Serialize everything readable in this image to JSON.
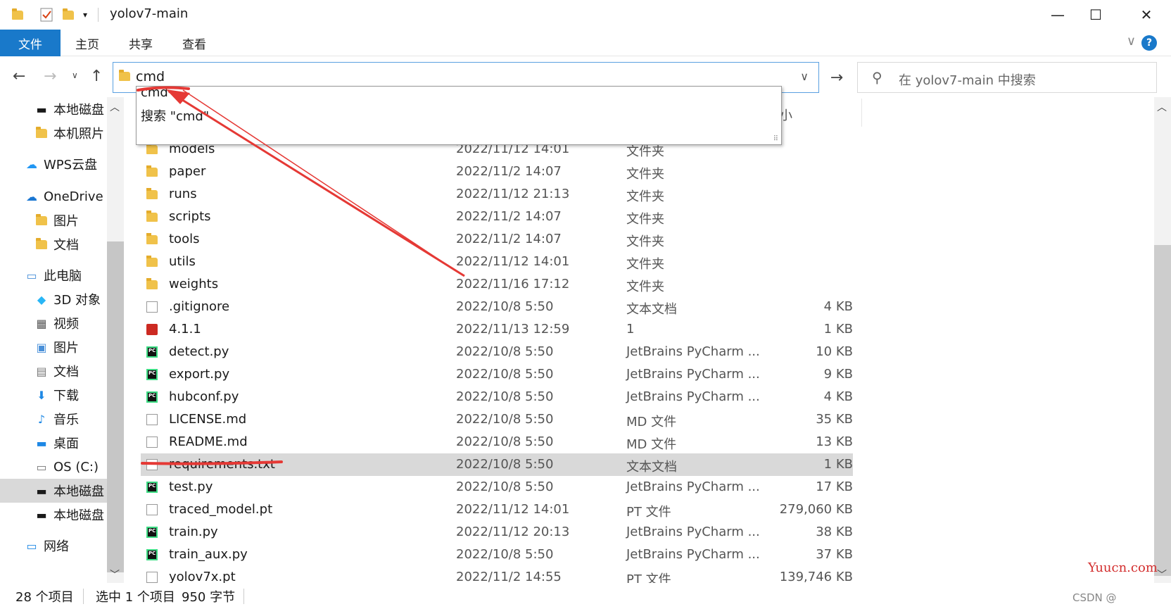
{
  "window": {
    "title": "yolov7-main",
    "minimize_icon": "—",
    "maximize_icon": "☐",
    "close_icon": "✕"
  },
  "ribbon": {
    "tabs": [
      "文件",
      "主页",
      "共享",
      "查看"
    ],
    "help": "?",
    "expand_icon": "∨"
  },
  "address": {
    "value": "cmd",
    "search_placeholder": "在 yolov7-main 中搜索"
  },
  "autocomplete": {
    "items": [
      "cmd",
      "搜索 \"cmd\""
    ]
  },
  "sidebar": {
    "items": [
      {
        "label": "本地磁盘",
        "icon": "drive-icon"
      },
      {
        "label": "本机照片",
        "icon": "folder-icon"
      },
      {
        "label": "WPS云盘",
        "icon": "cloud-icon"
      },
      {
        "label": "OneDrive",
        "icon": "onedrive-icon"
      },
      {
        "label": "图片",
        "icon": "folder-icon"
      },
      {
        "label": "文档",
        "icon": "folder-icon"
      },
      {
        "label": "此电脑",
        "icon": "computer-icon"
      },
      {
        "label": "3D 对象",
        "icon": "cube-icon"
      },
      {
        "label": "视频",
        "icon": "video-icon"
      },
      {
        "label": "图片",
        "icon": "pictures-icon"
      },
      {
        "label": "文档",
        "icon": "documents-icon"
      },
      {
        "label": "下载",
        "icon": "download-icon"
      },
      {
        "label": "音乐",
        "icon": "music-icon"
      },
      {
        "label": "桌面",
        "icon": "desktop-icon"
      },
      {
        "label": "OS (C:)",
        "icon": "os-drive-icon"
      },
      {
        "label": "本地磁盘",
        "icon": "drive-icon"
      },
      {
        "label": "本地磁盘",
        "icon": "drive-icon"
      },
      {
        "label": "网络",
        "icon": "network-icon"
      }
    ]
  },
  "list": {
    "size_header": "小",
    "rows": [
      {
        "name": "models",
        "date": "2022/11/12 14:01",
        "type": "文件夹",
        "size": "",
        "icon": "folder"
      },
      {
        "name": "paper",
        "date": "2022/11/2 14:07",
        "type": "文件夹",
        "size": "",
        "icon": "folder"
      },
      {
        "name": "runs",
        "date": "2022/11/12 21:13",
        "type": "文件夹",
        "size": "",
        "icon": "folder"
      },
      {
        "name": "scripts",
        "date": "2022/11/2 14:07",
        "type": "文件夹",
        "size": "",
        "icon": "folder"
      },
      {
        "name": "tools",
        "date": "2022/11/2 14:07",
        "type": "文件夹",
        "size": "",
        "icon": "folder"
      },
      {
        "name": "utils",
        "date": "2022/11/12 14:01",
        "type": "文件夹",
        "size": "",
        "icon": "folder"
      },
      {
        "name": "weights",
        "date": "2022/11/16 17:12",
        "type": "文件夹",
        "size": "",
        "icon": "folder"
      },
      {
        "name": ".gitignore",
        "date": "2022/10/8 5:50",
        "type": "文本文档",
        "size": "4 KB",
        "icon": "doc"
      },
      {
        "name": "4.1.1",
        "date": "2022/11/13 12:59",
        "type": "1",
        "size": "1 KB",
        "icon": "red"
      },
      {
        "name": "detect.py",
        "date": "2022/10/8 5:50",
        "type": "JetBrains PyCharm ...",
        "size": "10 KB",
        "icon": "py"
      },
      {
        "name": "export.py",
        "date": "2022/10/8 5:50",
        "type": "JetBrains PyCharm ...",
        "size": "9 KB",
        "icon": "py"
      },
      {
        "name": "hubconf.py",
        "date": "2022/10/8 5:50",
        "type": "JetBrains PyCharm ...",
        "size": "4 KB",
        "icon": "py"
      },
      {
        "name": "LICENSE.md",
        "date": "2022/10/8 5:50",
        "type": "MD 文件",
        "size": "35 KB",
        "icon": "doc"
      },
      {
        "name": "README.md",
        "date": "2022/10/8 5:50",
        "type": "MD 文件",
        "size": "13 KB",
        "icon": "doc"
      },
      {
        "name": "requirements.txt",
        "date": "2022/10/8 5:50",
        "type": "文本文档",
        "size": "1 KB",
        "icon": "doc",
        "selected": true
      },
      {
        "name": "test.py",
        "date": "2022/10/8 5:50",
        "type": "JetBrains PyCharm ...",
        "size": "17 KB",
        "icon": "py"
      },
      {
        "name": "traced_model.pt",
        "date": "2022/11/12 14:01",
        "type": "PT 文件",
        "size": "279,060 KB",
        "icon": "doc"
      },
      {
        "name": "train.py",
        "date": "2022/11/12 20:13",
        "type": "JetBrains PyCharm ...",
        "size": "38 KB",
        "icon": "py"
      },
      {
        "name": "train_aux.py",
        "date": "2022/10/8 5:50",
        "type": "JetBrains PyCharm ...",
        "size": "37 KB",
        "icon": "py"
      },
      {
        "name": "yolov7x.pt",
        "date": "2022/11/2 14:55",
        "type": "PT 文件",
        "size": "139,746 KB",
        "icon": "doc"
      }
    ]
  },
  "status": {
    "count": "28 个项目",
    "selected": "选中 1 个项目",
    "size": "950 字节"
  },
  "watermarks": {
    "site": "Yuucn.com",
    "csdn": "CSDN @"
  },
  "colors": {
    "accent": "#1979ca",
    "annotation": "#e53935",
    "selection": "#d9d9d9"
  }
}
